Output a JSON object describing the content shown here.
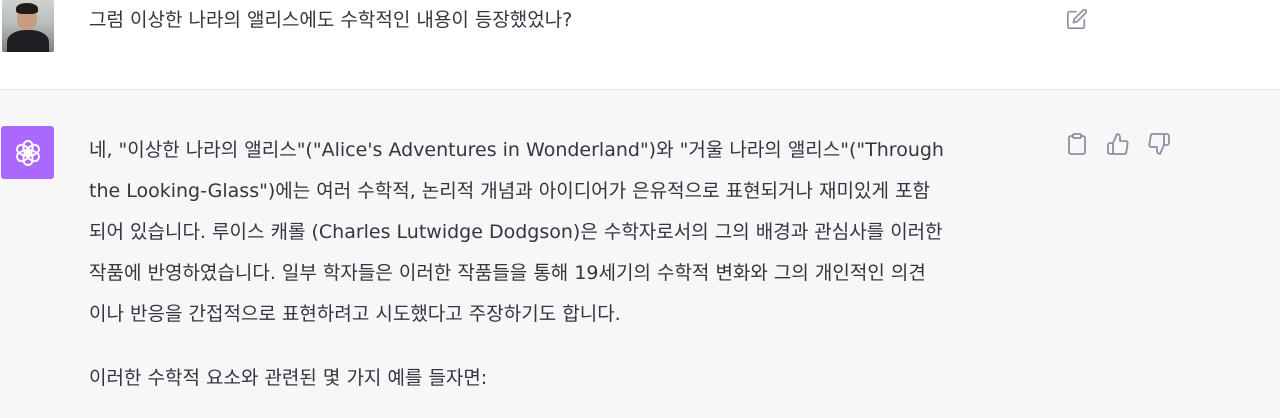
{
  "user_message": {
    "avatar": "user-photo",
    "text": "그럼 이상한 나라의 앨리스에도 수학적인 내용이 등장했었나?",
    "edit_icon": "edit-icon"
  },
  "assistant_message": {
    "avatar": "openai-logo",
    "avatar_color": "#ab68ff",
    "lines": [
      "네, \"이상한 나라의 앨리스\"(\"Alice's Adventures in Wonderland\")와 \"거울 나라의 앨리스\"(\"Through",
      "the Looking-Glass\")에는 여러 수학적, 논리적 개념과 아이디어가 은유적으로 표현되거나 재미있게 포함",
      "되어 있습니다. 루이스 캐롤 (Charles Lutwidge Dodgson)은 수학자로서의 그의 배경과 관심사를 이러한",
      "작품에 반영하였습니다. 일부 학자들은 이러한 작품들을 통해 19세기의 수학적 변화와 그의 개인적인 의견",
      "이나 반응을 간접적으로 표현하려고 시도했다고 주장하기도 합니다."
    ],
    "second_paragraph": "이러한 수학적 요소와 관련된 몇 가지 예를 들자면:",
    "actions": [
      "clipboard-icon",
      "thumbs-up-icon",
      "thumbs-down-icon"
    ]
  }
}
